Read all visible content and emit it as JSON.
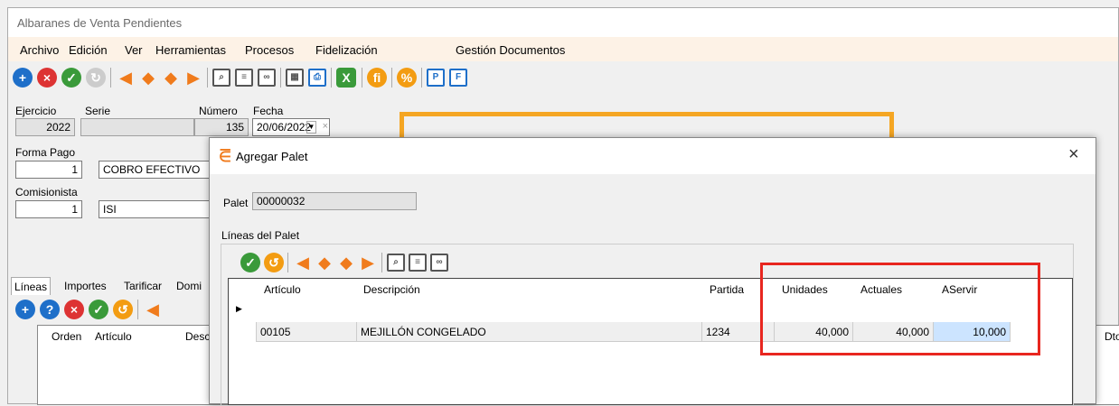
{
  "window": {
    "title": "Albaranes de Venta Pendientes"
  },
  "menu": [
    "Archivo",
    "Edición",
    "Ver",
    "Herramientas",
    "Procesos",
    "Fidelización",
    "Gestión Documentos"
  ],
  "toolbar": {
    "icons": [
      "add-icon",
      "delete-icon",
      "accept-icon",
      "refresh-icon",
      "first-icon",
      "prev-icon",
      "next-icon",
      "last-icon",
      "search-icon",
      "filter-icon",
      "binoculars-icon",
      "calculator-icon",
      "print-icon",
      "excel-icon",
      "fi-icon",
      "percent-icon",
      "p-icon",
      "f-icon"
    ]
  },
  "header": {
    "ejercicio_label": "Ejercicio",
    "ejercicio_value": "2022",
    "serie_label": "Serie",
    "serie_value": "",
    "numero_label": "Número",
    "numero_value": "135",
    "fecha_label": "Fecha",
    "fecha_value": "20/06/2022",
    "forma_pago_label": "Forma Pago",
    "forma_pago_code": "1",
    "forma_pago_desc": "COBRO EFECTIVO",
    "comisionista_label": "Comisionista",
    "comisionista_code": "1",
    "comisionista_desc": "ISI"
  },
  "tabs": [
    "Líneas",
    "Importes",
    "Tarificar",
    "Domi"
  ],
  "lines_grid": {
    "headers": [
      "Orden",
      "Artículo",
      "Desc"
    ],
    "right_header": "Dto"
  },
  "dialog": {
    "title": "Agregar Palet",
    "close": "×",
    "palet_label": "Palet",
    "palet_value": "00000032",
    "group_label": "Líneas del Palet",
    "columns": [
      "Artículo",
      "Descripción",
      "Partida",
      "Unidades",
      "Actuales",
      "AServir"
    ],
    "rows": [
      {
        "articulo": "00105",
        "descripcion": "MEJILLÓN CONGELADO",
        "partida": "1234",
        "unidades": "40,000",
        "actuales": "40,000",
        "aservir": "10,000"
      }
    ]
  },
  "colors": {
    "accent": "#f07b1c",
    "highlight_box": "#e8261f",
    "selected_cell": "#cce4ff"
  }
}
